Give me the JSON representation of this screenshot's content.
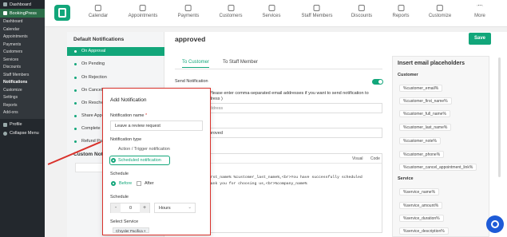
{
  "wp_sidebar": {
    "dashboard": "Dashboard",
    "plugin": "BookingPress",
    "items": [
      "Dashboard",
      "Calendar",
      "Appointments",
      "Payments",
      "Customers",
      "Services",
      "Discounts",
      "Staff Members",
      "Notifications",
      "Customize",
      "Settings",
      "Reports",
      "Add-ons"
    ],
    "profile": "Profile",
    "collapse": "Collapse Menu"
  },
  "topnav": {
    "items": [
      "Calendar",
      "Appointments",
      "Payments",
      "Customers",
      "Services",
      "Staff Members",
      "Discounts",
      "Reports",
      "Customize",
      "More"
    ]
  },
  "left": {
    "title": "Default Notifications",
    "items": [
      "On Approval",
      "On Pending",
      "On Rejection",
      "On Cancella",
      "On Resched",
      "Share Appo",
      "Complete",
      "Refund Pay"
    ],
    "custom_title": "Custom Notifi"
  },
  "main": {
    "title": "approved",
    "save": "Save",
    "tabs": [
      "To Customer",
      "To Staff Member"
    ],
    "send_notification": "Send Notification",
    "cc_hint": "Please enter comma-separated email addresses if you want to send notification to",
    "cc_hint2": "dress )",
    "address_ph": "Address",
    "subject_value": "pproved",
    "visual": "Visual",
    "code": "Code",
    "code_text": "first_name% %customer_last_name%,<br>You have successfully scheduled\nThank you for choosing us,<br>%company_name%"
  },
  "placeholders": {
    "title": "Insert email placeholders",
    "customer_section": "Customer",
    "customer": [
      "%customer_email%",
      "%customer_first_name%",
      "%customer_full_name%",
      "%customer_last_name%",
      "%customer_note%",
      "%customer_phone%",
      "%customer_cancel_appointment_link%"
    ],
    "service_section": "Service",
    "service": [
      "%service_name%",
      "%service_amount%",
      "%service_duration%",
      "%service_description%"
    ]
  },
  "modal": {
    "title": "Add Notification",
    "name_label": "Notification name",
    "required": "*",
    "name_value": "Leave a review request",
    "type_label": "Notification type",
    "type_action": "Action / Trigger notification",
    "type_scheduled": "Scheduled notification",
    "schedule_label": "Schedule",
    "before": "Before",
    "after": "After",
    "schedule2_label": "Schedule",
    "minus": "-",
    "plus": "+",
    "amount": "0",
    "unit": "Hours",
    "select_service_label": "Select Service",
    "service_tag": "Chrysler Pacifica",
    "tag_close": "×"
  },
  "colors": {
    "accent": "#12a67a",
    "highlight": "#d9312b",
    "wp_dark": "#23282d"
  }
}
